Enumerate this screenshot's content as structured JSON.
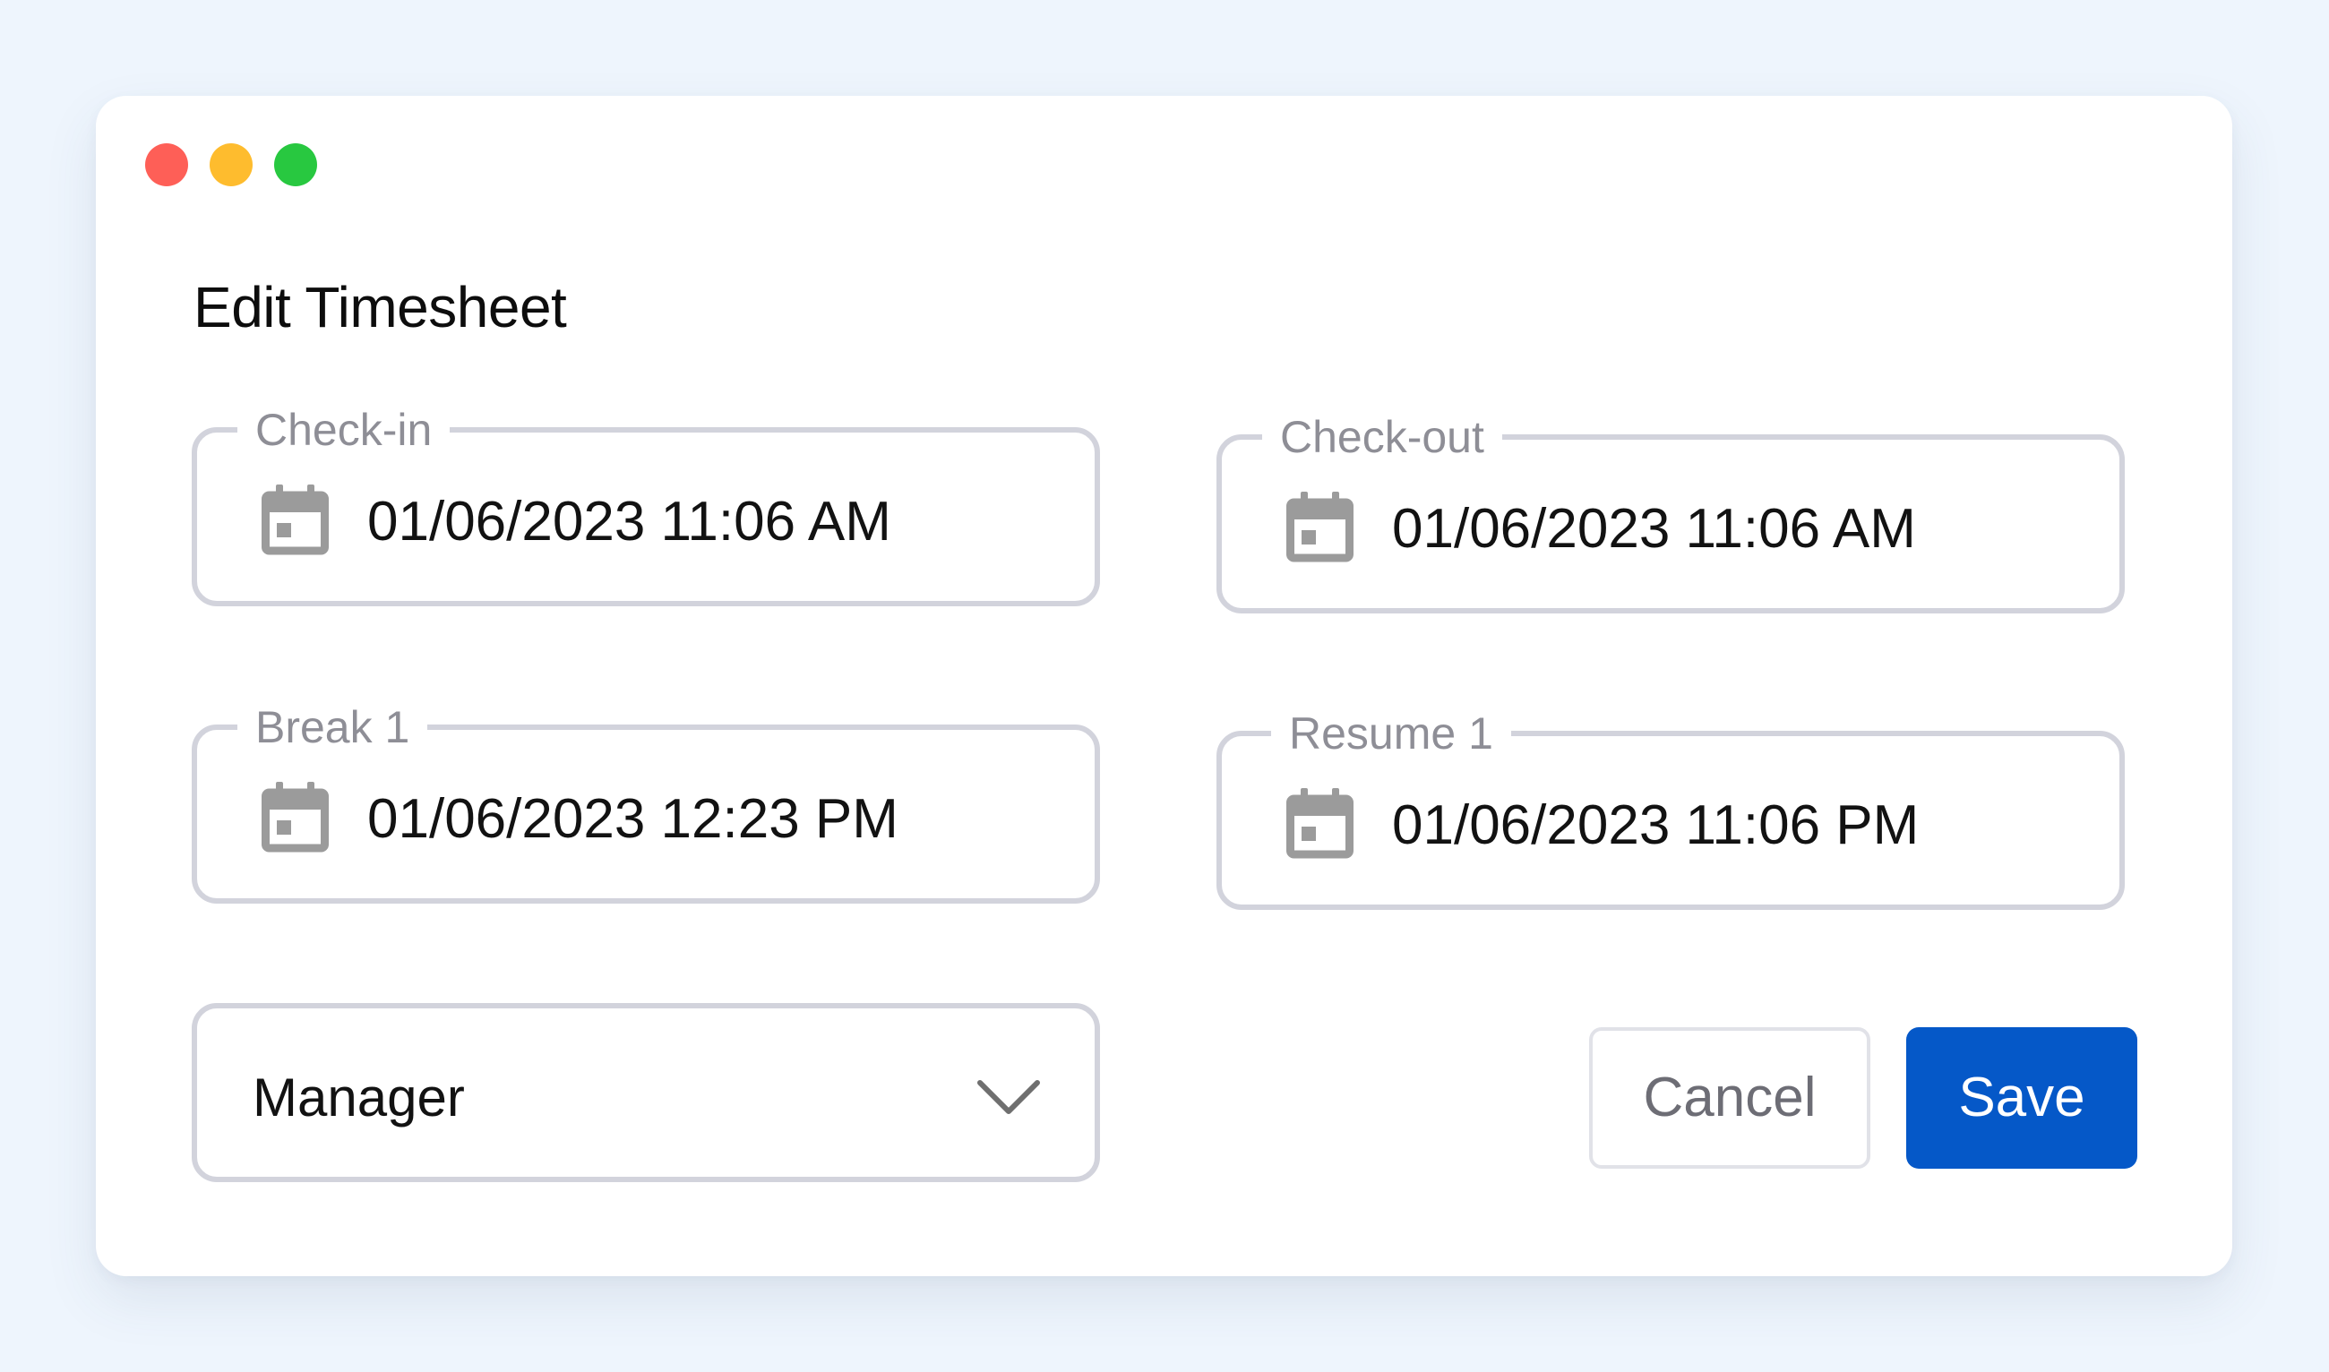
{
  "window": {
    "controls": {
      "close_color": "#fe5f57",
      "minimize_color": "#febc2e",
      "maximize_color": "#28c840"
    }
  },
  "dialog": {
    "title": "Edit Timesheet",
    "fields": {
      "check_in": {
        "label": "Check-in",
        "value": "01/06/2023 11:06 AM"
      },
      "check_out": {
        "label": "Check-out",
        "value": "01/06/2023 11:06 AM"
      },
      "break_1": {
        "label": "Break 1",
        "value": "01/06/2023 12:23 PM"
      },
      "resume_1": {
        "label": "Resume 1",
        "value": "01/06/2023 11:06 PM"
      }
    },
    "role_select": {
      "value": "Manager"
    },
    "buttons": {
      "cancel": "Cancel",
      "save": "Save"
    }
  },
  "colors": {
    "accent": "#0558c8",
    "field_border": "#d2d3dc",
    "label": "#8e8e96",
    "icon": "#9b9b9b"
  },
  "icons": {
    "datetime_fields": "calendar-icon",
    "select": "chevron-down-icon"
  }
}
